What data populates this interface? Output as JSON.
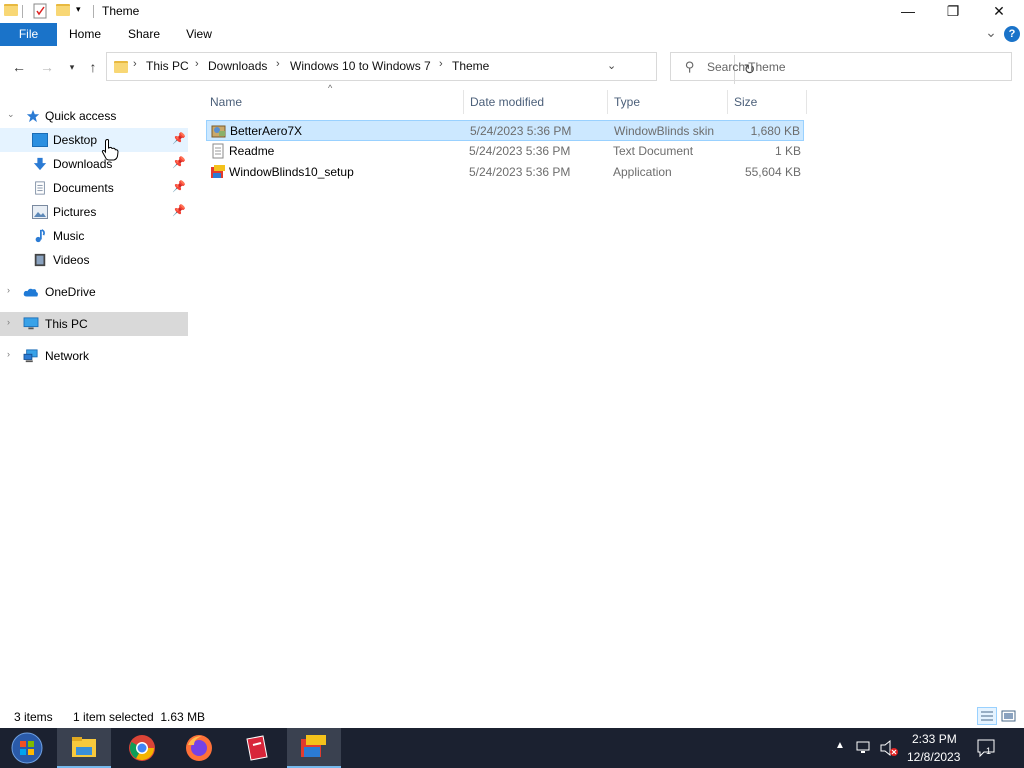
{
  "window": {
    "title": "Theme",
    "controls": {
      "minimize": "—",
      "maximize": "❐",
      "close": "✕"
    }
  },
  "ribbon": {
    "tabs": [
      "File",
      "Home",
      "Share",
      "View"
    ],
    "expand_glyph": "⌄",
    "help_glyph": "?"
  },
  "address": {
    "breadcrumbs": [
      "This PC",
      "Downloads",
      "Windows 10 to Windows 7",
      "Theme"
    ],
    "chevron": "›"
  },
  "search": {
    "placeholder": "Search Theme"
  },
  "nav": {
    "items": [
      {
        "label": "Quick access",
        "icon": "star-icon",
        "pinned": false
      },
      {
        "label": "Desktop",
        "icon": "desktop-icon",
        "pinned": true
      },
      {
        "label": "Downloads",
        "icon": "download-icon",
        "pinned": true
      },
      {
        "label": "Documents",
        "icon": "document-icon",
        "pinned": true
      },
      {
        "label": "Pictures",
        "icon": "pictures-icon",
        "pinned": true
      },
      {
        "label": "Music",
        "icon": "music-icon",
        "pinned": false
      },
      {
        "label": "Videos",
        "icon": "video-icon",
        "pinned": false
      },
      {
        "label": "OneDrive",
        "icon": "cloud-icon",
        "pinned": false
      },
      {
        "label": "This PC",
        "icon": "computer-icon",
        "pinned": false
      },
      {
        "label": "Network",
        "icon": "network-icon",
        "pinned": false
      }
    ]
  },
  "files": {
    "columns": [
      "Name",
      "Date modified",
      "Type",
      "Size"
    ],
    "rows": [
      {
        "name": "BetterAero7X",
        "date": "5/24/2023 5:36 PM",
        "type": "WindowBlinds skin",
        "size": "1,680 KB",
        "icon": "skin-file-icon",
        "selected": true
      },
      {
        "name": "Readme",
        "date": "5/24/2023 5:36 PM",
        "type": "Text Document",
        "size": "1 KB",
        "icon": "text-file-icon",
        "selected": false
      },
      {
        "name": "WindowBlinds10_setup",
        "date": "5/24/2023 5:36 PM",
        "type": "Application",
        "size": "55,604 KB",
        "icon": "installer-icon",
        "selected": false
      }
    ]
  },
  "status": {
    "item_count": "3 items",
    "selection": "1 item selected  1.63 MB"
  },
  "taskbar": {
    "apps": [
      "start-orb-icon",
      "file-explorer-icon",
      "chrome-icon",
      "firefox-icon",
      "app-red-icon",
      "windowblinds-icon"
    ],
    "time": "2:33 PM",
    "date": "12/8/2023",
    "notification_count": "1"
  },
  "colors": {
    "accent": "#1a73c9",
    "selection_bg": "#cce8ff",
    "selection_border": "#99d1ff",
    "taskbar": "#1b2130"
  }
}
